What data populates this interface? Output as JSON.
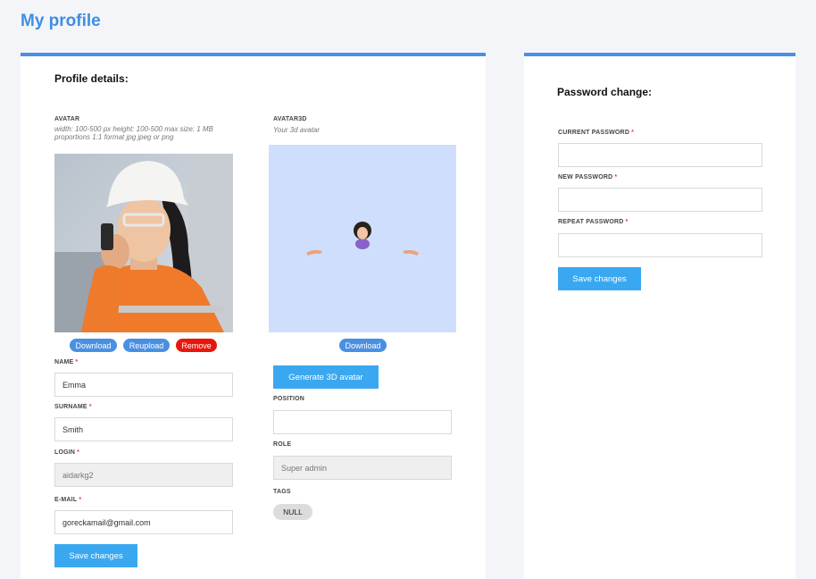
{
  "page": {
    "title": "My profile"
  },
  "profile": {
    "section_title": "Profile details:",
    "avatar": {
      "label": "AVATAR",
      "hint_line1": "width: 100-500 px height: 100-500 max size: 1 MB",
      "hint_line2": "proportions 1:1 format jpg jpeg or png",
      "download_label": "Download",
      "reupload_label": "Reupload",
      "remove_label": "Remove"
    },
    "avatar3d": {
      "label": "AVATAR3D",
      "hint": "Your 3d avatar",
      "download_label": "Download",
      "generate_label": "Generate 3D avatar"
    },
    "fields": {
      "name_label": "NAME",
      "name_value": "Emma",
      "surname_label": "SURNAME",
      "surname_value": "Smith",
      "login_label": "LOGIN",
      "login_value": "aidarkg2",
      "email_label": "E-MAIL",
      "email_value": "goreckamail@gmail.com",
      "position_label": "POSITION",
      "position_value": "",
      "role_label": "ROLE",
      "role_value": "Super admin",
      "tags_label": "TAGS",
      "tag_value": "NULL",
      "required_mark": "*"
    },
    "save_label": "Save changes"
  },
  "password": {
    "section_title": "Password change:",
    "current_label": "CURRENT PASSWORD",
    "new_label": "NEW PASSWORD",
    "repeat_label": "REPEAT PASSWORD",
    "required_mark": "*",
    "save_label": "Save changes"
  },
  "colors": {
    "accent": "#4a90e2",
    "button": "#3aa8f0",
    "danger": "#e8160c",
    "avatar3d_bg": "#cfdefc"
  }
}
